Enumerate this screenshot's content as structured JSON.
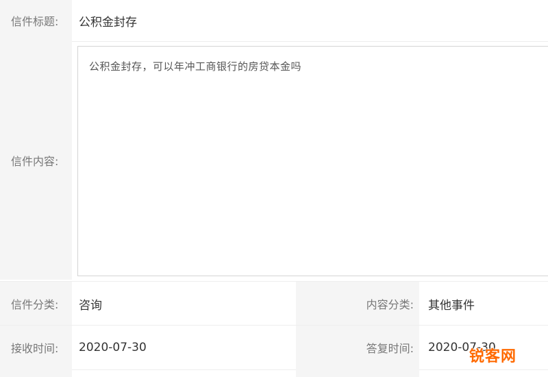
{
  "letter": {
    "title_label": "信件标题:",
    "title_value": "公积金封存",
    "content_label": "信件内容:",
    "content_value": "公积金封存，可以年冲工商银行的房贷本金吗",
    "category_label": "信件分类:",
    "category_value": "咨询",
    "content_category_label": "内容分类:",
    "content_category_value": "其他事件",
    "received_label": "接收时间:",
    "received_value": "2020-07-30",
    "reply_label": "答复时间:",
    "reply_value": "2020-07-30"
  },
  "watermark": {
    "text": "锐客网"
  }
}
